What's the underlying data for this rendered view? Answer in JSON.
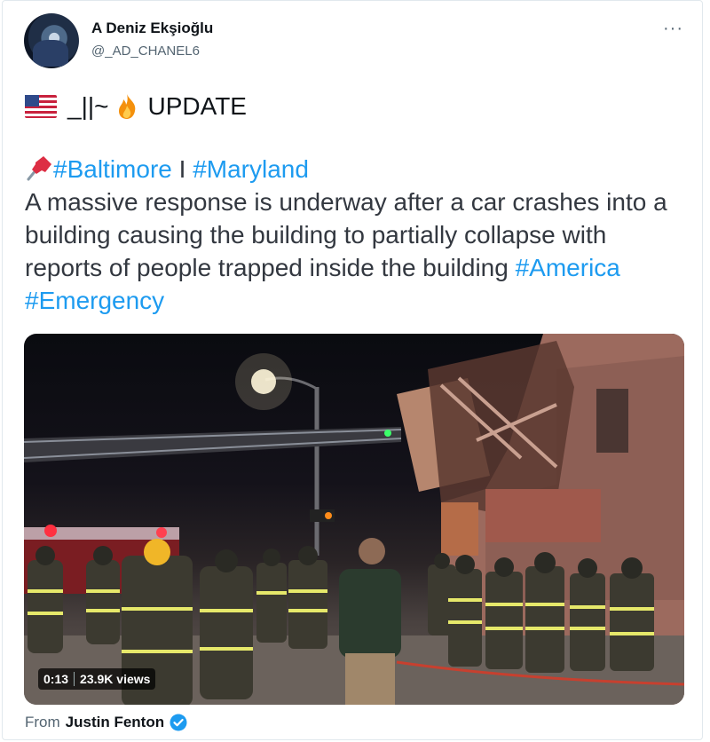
{
  "author": {
    "display_name": "A Deniz Ekşioğlu",
    "handle": "@_AD_CHANEL6"
  },
  "more_label": "···",
  "tweet": {
    "line1_prefix": "_||~",
    "line1_update": "UPDATE",
    "tag_baltimore": "#Baltimore",
    "separator": "I",
    "tag_maryland": "#Maryland",
    "body": "A massive response is underway after a car crashes into a building causing the building to partially collapse with reports of people trapped inside the building",
    "tag_america": "#America",
    "tag_emergency": "#Emergency"
  },
  "media": {
    "duration": "0:13",
    "views": "23.9K views"
  },
  "source": {
    "prefix": "From",
    "name": "Justin Fenton"
  },
  "colors": {
    "link": "#1d9bf0",
    "verified": "#1d9bf0"
  }
}
